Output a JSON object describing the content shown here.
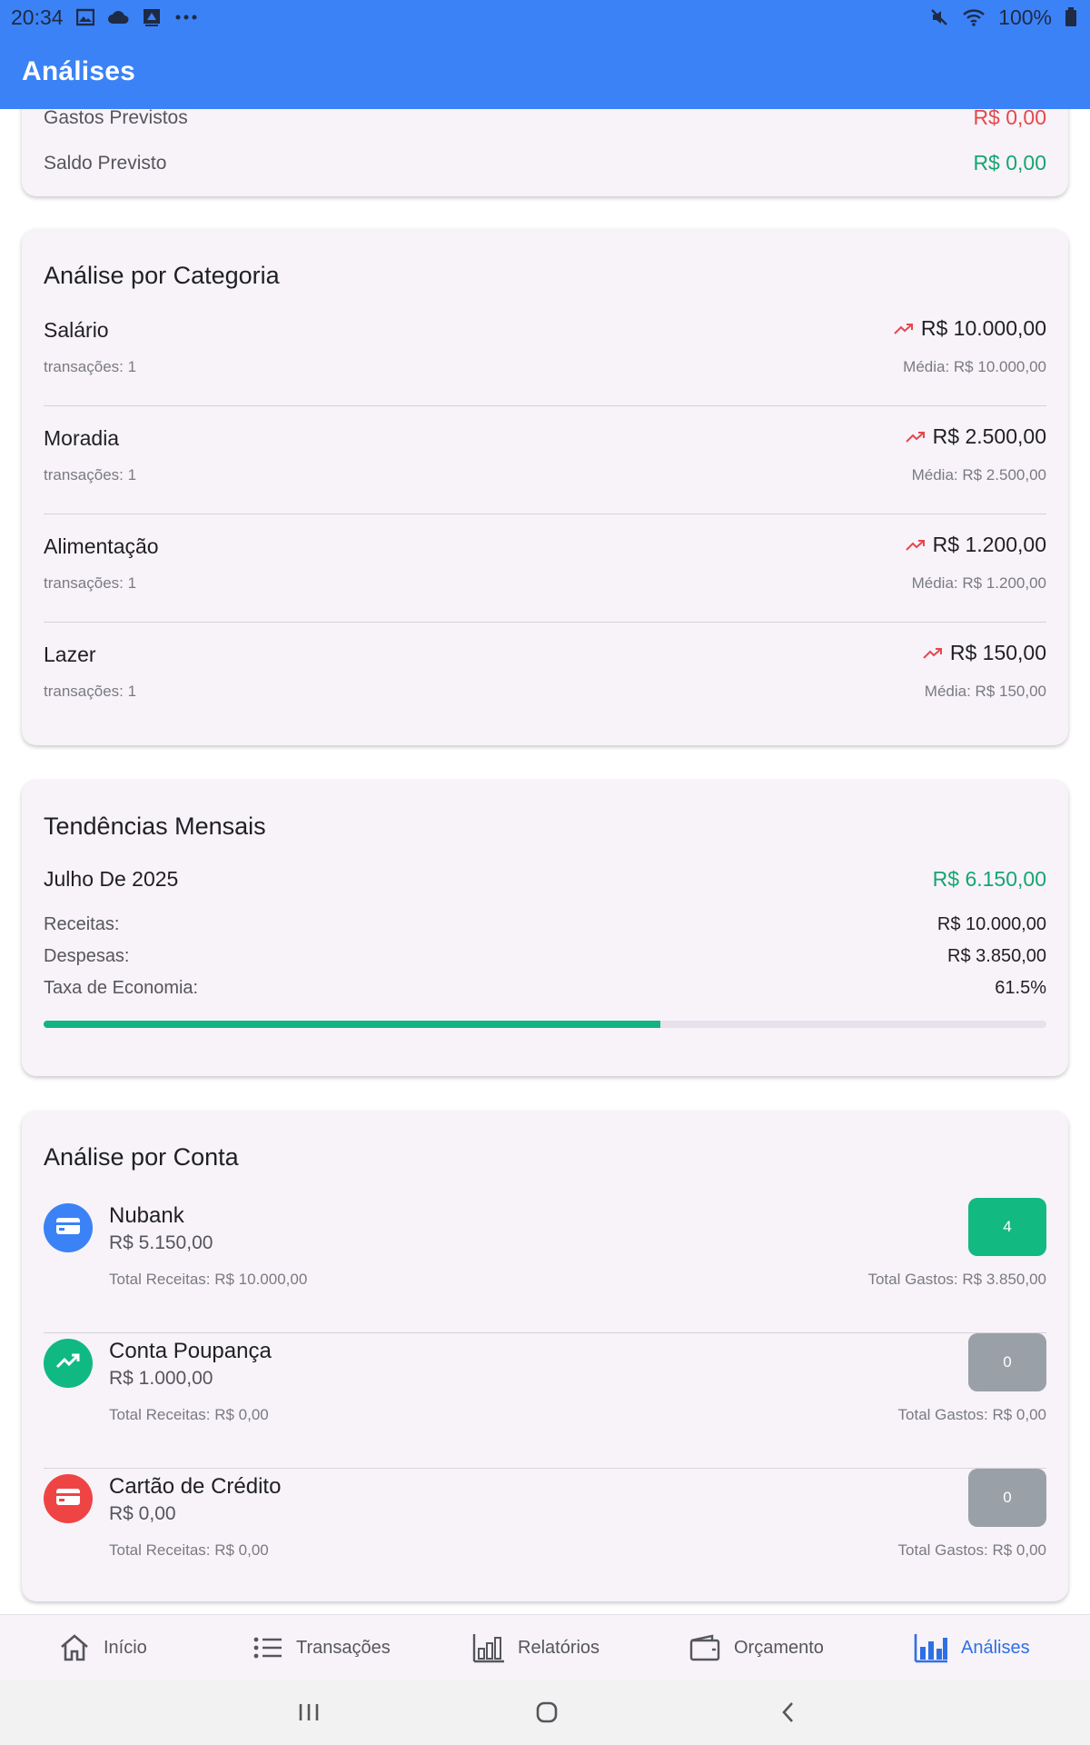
{
  "status_bar": {
    "time": "20:34",
    "battery": "100%",
    "left_icons": [
      "gallery-icon",
      "cloud-icon",
      "screenshot-icon",
      "more-dots-icon"
    ],
    "right_icons": [
      "mute-icon",
      "wifi-icon",
      "battery-icon"
    ]
  },
  "app_bar": {
    "title": "Análises"
  },
  "summary": {
    "rows": [
      {
        "label": "Gastos Previstos",
        "value": "R$ 0,00",
        "color": "#e5484d"
      },
      {
        "label": "Saldo Previsto",
        "value": "R$ 0,00",
        "color": "#16a56f"
      }
    ]
  },
  "category_analysis": {
    "title": "Análise por Categoria",
    "items": [
      {
        "name": "Salário",
        "count": "transações: 1",
        "amount": "R$ 10.000,00",
        "average": "Média: R$ 10.000,00",
        "icon": "trending-up-icon"
      },
      {
        "name": "Moradia",
        "count": "transações: 1",
        "amount": "R$ 2.500,00",
        "average": "Média: R$ 2.500,00",
        "icon": "trending-up-icon"
      },
      {
        "name": "Alimentação",
        "count": "transações: 1",
        "amount": "R$ 1.200,00",
        "average": "Média: R$ 1.200,00",
        "icon": "trending-up-icon"
      },
      {
        "name": "Lazer",
        "count": "transações: 1",
        "amount": "R$ 150,00",
        "average": "Média: R$ 150,00",
        "icon": "trending-up-icon"
      }
    ]
  },
  "monthly_trends": {
    "title": "Tendências Mensais",
    "month": "Julho De 2025",
    "net": "R$ 6.150,00",
    "income_label": "Receitas:",
    "income_value": "R$ 10.000,00",
    "expense_label": "Despesas:",
    "expense_value": "R$ 3.850,00",
    "savings_label": "Taxa de Economia:",
    "savings_value": "61.5%",
    "savings_fraction": 0.615,
    "progress_color": "#12b481"
  },
  "account_analysis": {
    "title": "Análise por Conta",
    "items": [
      {
        "name": "Nubank",
        "balance": "R$ 5.150,00",
        "income": "Total Receitas: R$ 10.000,00",
        "expenses": "Total Gastos: R$ 3.850,00",
        "badge": "4",
        "icon": "credit-card-icon",
        "icon_color": "#3b82f6",
        "badge_color": "#12b981"
      },
      {
        "name": "Conta Poupança",
        "balance": "R$ 1.000,00",
        "income": "Total Receitas: R$ 0,00",
        "expenses": "Total Gastos: R$ 0,00",
        "badge": "0",
        "icon": "trending-up-icon",
        "icon_color": "#10b981",
        "badge_color": "#9aa0a8"
      },
      {
        "name": "Cartão de Crédito",
        "balance": "R$ 0,00",
        "income": "Total Receitas: R$ 0,00",
        "expenses": "Total Gastos: R$ 0,00",
        "badge": "0",
        "icon": "credit-card-icon",
        "icon_color": "#ef4444",
        "badge_color": "#9aa0a8"
      }
    ]
  },
  "bottom_nav": {
    "items": [
      {
        "label": "Início",
        "icon": "home-icon",
        "active": false
      },
      {
        "label": "Transações",
        "icon": "list-icon",
        "active": false
      },
      {
        "label": "Relatórios",
        "icon": "bar-chart-outline-icon",
        "active": false
      },
      {
        "label": "Orçamento",
        "icon": "wallet-icon",
        "active": false
      },
      {
        "label": "Análises",
        "icon": "bar-chart-icon",
        "active": true
      }
    ],
    "active_color": "#2f6fe4"
  },
  "system_nav": {
    "buttons": [
      "recents-icon",
      "home-circle-icon",
      "back-icon"
    ]
  }
}
